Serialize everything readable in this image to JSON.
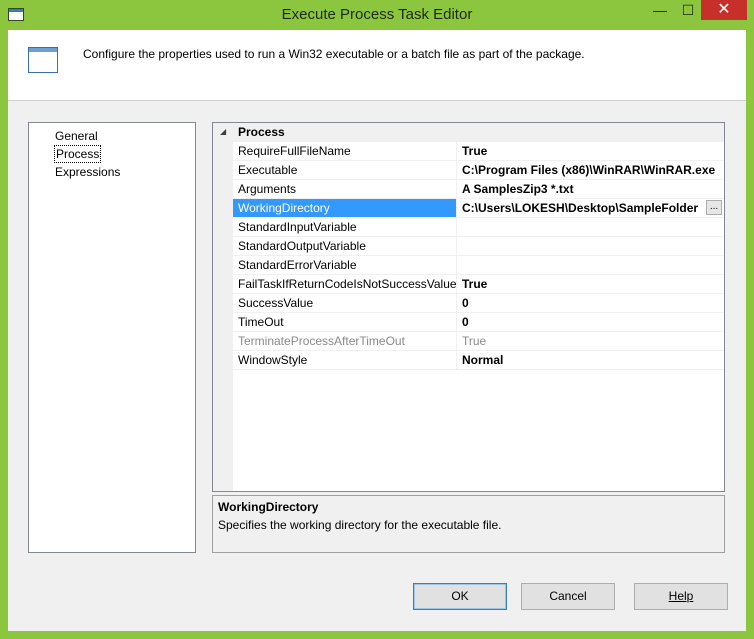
{
  "window": {
    "title": "Execute Process Task Editor",
    "icons": {
      "app": "window-icon",
      "minimize": "minimize-icon",
      "maximize": "maximize-icon",
      "close": "close-icon"
    },
    "controls": {
      "minimize": "—",
      "maximize": "☐",
      "close": "✕"
    }
  },
  "header": {
    "icon": "window-icon",
    "text": "Configure the properties used to run a Win32 executable or a batch file as part of the package."
  },
  "nav": {
    "items": [
      {
        "label": "General",
        "selected": false
      },
      {
        "label": "Process",
        "selected": true
      },
      {
        "label": "Expressions",
        "selected": false
      }
    ]
  },
  "grid": {
    "category": "Process",
    "properties": [
      {
        "name": "RequireFullFileName",
        "value": "True",
        "bold": true
      },
      {
        "name": "Executable",
        "value": "C:\\Program Files (x86)\\WinRAR\\WinRAR.exe",
        "bold": true
      },
      {
        "name": "Arguments",
        "value": "A SamplesZip3 *.txt",
        "bold": true
      },
      {
        "name": "WorkingDirectory",
        "value": "C:\\Users\\LOKESH\\Desktop\\SampleFolder",
        "bold": true,
        "selected": true
      },
      {
        "name": "StandardInputVariable",
        "value": ""
      },
      {
        "name": "StandardOutputVariable",
        "value": ""
      },
      {
        "name": "StandardErrorVariable",
        "value": ""
      },
      {
        "name": "FailTaskIfReturnCodeIsNotSuccessValue",
        "value": "True",
        "bold": true
      },
      {
        "name": "SuccessValue",
        "value": "0",
        "bold": true
      },
      {
        "name": "TimeOut",
        "value": "0",
        "bold": true
      },
      {
        "name": "TerminateProcessAfterTimeOut",
        "value": "True",
        "disabled": true
      },
      {
        "name": "WindowStyle",
        "value": "Normal",
        "bold": true
      }
    ],
    "ellipsis_label": "..."
  },
  "description": {
    "title": "WorkingDirectory",
    "text": "Specifies the working directory for the executable file."
  },
  "buttons": {
    "ok": "OK",
    "cancel": "Cancel",
    "help": "Help"
  },
  "colors": {
    "frame": "#8cc63f",
    "selection": "#3399ff",
    "close": "#c7302a"
  }
}
